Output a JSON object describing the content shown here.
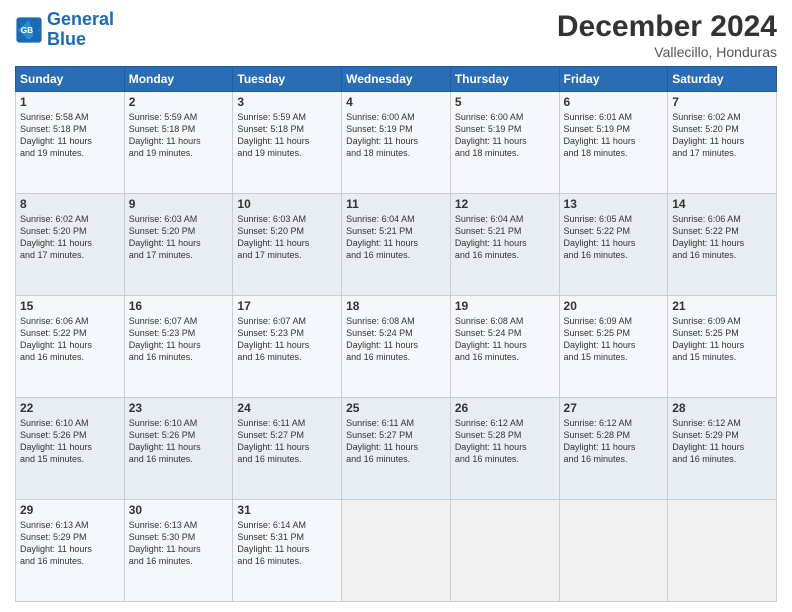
{
  "logo": {
    "line1": "General",
    "line2": "Blue"
  },
  "title": "December 2024",
  "subtitle": "Vallecillo, Honduras",
  "days_header": [
    "Sunday",
    "Monday",
    "Tuesday",
    "Wednesday",
    "Thursday",
    "Friday",
    "Saturday"
  ],
  "weeks": [
    [
      {
        "day": "1",
        "info": "Sunrise: 5:58 AM\nSunset: 5:18 PM\nDaylight: 11 hours\nand 19 minutes."
      },
      {
        "day": "2",
        "info": "Sunrise: 5:59 AM\nSunset: 5:18 PM\nDaylight: 11 hours\nand 19 minutes."
      },
      {
        "day": "3",
        "info": "Sunrise: 5:59 AM\nSunset: 5:18 PM\nDaylight: 11 hours\nand 19 minutes."
      },
      {
        "day": "4",
        "info": "Sunrise: 6:00 AM\nSunset: 5:19 PM\nDaylight: 11 hours\nand 18 minutes."
      },
      {
        "day": "5",
        "info": "Sunrise: 6:00 AM\nSunset: 5:19 PM\nDaylight: 11 hours\nand 18 minutes."
      },
      {
        "day": "6",
        "info": "Sunrise: 6:01 AM\nSunset: 5:19 PM\nDaylight: 11 hours\nand 18 minutes."
      },
      {
        "day": "7",
        "info": "Sunrise: 6:02 AM\nSunset: 5:20 PM\nDaylight: 11 hours\nand 17 minutes."
      }
    ],
    [
      {
        "day": "8",
        "info": "Sunrise: 6:02 AM\nSunset: 5:20 PM\nDaylight: 11 hours\nand 17 minutes."
      },
      {
        "day": "9",
        "info": "Sunrise: 6:03 AM\nSunset: 5:20 PM\nDaylight: 11 hours\nand 17 minutes."
      },
      {
        "day": "10",
        "info": "Sunrise: 6:03 AM\nSunset: 5:20 PM\nDaylight: 11 hours\nand 17 minutes."
      },
      {
        "day": "11",
        "info": "Sunrise: 6:04 AM\nSunset: 5:21 PM\nDaylight: 11 hours\nand 16 minutes."
      },
      {
        "day": "12",
        "info": "Sunrise: 6:04 AM\nSunset: 5:21 PM\nDaylight: 11 hours\nand 16 minutes."
      },
      {
        "day": "13",
        "info": "Sunrise: 6:05 AM\nSunset: 5:22 PM\nDaylight: 11 hours\nand 16 minutes."
      },
      {
        "day": "14",
        "info": "Sunrise: 6:06 AM\nSunset: 5:22 PM\nDaylight: 11 hours\nand 16 minutes."
      }
    ],
    [
      {
        "day": "15",
        "info": "Sunrise: 6:06 AM\nSunset: 5:22 PM\nDaylight: 11 hours\nand 16 minutes."
      },
      {
        "day": "16",
        "info": "Sunrise: 6:07 AM\nSunset: 5:23 PM\nDaylight: 11 hours\nand 16 minutes."
      },
      {
        "day": "17",
        "info": "Sunrise: 6:07 AM\nSunset: 5:23 PM\nDaylight: 11 hours\nand 16 minutes."
      },
      {
        "day": "18",
        "info": "Sunrise: 6:08 AM\nSunset: 5:24 PM\nDaylight: 11 hours\nand 16 minutes."
      },
      {
        "day": "19",
        "info": "Sunrise: 6:08 AM\nSunset: 5:24 PM\nDaylight: 11 hours\nand 16 minutes."
      },
      {
        "day": "20",
        "info": "Sunrise: 6:09 AM\nSunset: 5:25 PM\nDaylight: 11 hours\nand 15 minutes."
      },
      {
        "day": "21",
        "info": "Sunrise: 6:09 AM\nSunset: 5:25 PM\nDaylight: 11 hours\nand 15 minutes."
      }
    ],
    [
      {
        "day": "22",
        "info": "Sunrise: 6:10 AM\nSunset: 5:26 PM\nDaylight: 11 hours\nand 15 minutes."
      },
      {
        "day": "23",
        "info": "Sunrise: 6:10 AM\nSunset: 5:26 PM\nDaylight: 11 hours\nand 16 minutes."
      },
      {
        "day": "24",
        "info": "Sunrise: 6:11 AM\nSunset: 5:27 PM\nDaylight: 11 hours\nand 16 minutes."
      },
      {
        "day": "25",
        "info": "Sunrise: 6:11 AM\nSunset: 5:27 PM\nDaylight: 11 hours\nand 16 minutes."
      },
      {
        "day": "26",
        "info": "Sunrise: 6:12 AM\nSunset: 5:28 PM\nDaylight: 11 hours\nand 16 minutes."
      },
      {
        "day": "27",
        "info": "Sunrise: 6:12 AM\nSunset: 5:28 PM\nDaylight: 11 hours\nand 16 minutes."
      },
      {
        "day": "28",
        "info": "Sunrise: 6:12 AM\nSunset: 5:29 PM\nDaylight: 11 hours\nand 16 minutes."
      }
    ],
    [
      {
        "day": "29",
        "info": "Sunrise: 6:13 AM\nSunset: 5:29 PM\nDaylight: 11 hours\nand 16 minutes."
      },
      {
        "day": "30",
        "info": "Sunrise: 6:13 AM\nSunset: 5:30 PM\nDaylight: 11 hours\nand 16 minutes."
      },
      {
        "day": "31",
        "info": "Sunrise: 6:14 AM\nSunset: 5:31 PM\nDaylight: 11 hours\nand 16 minutes."
      },
      {
        "day": "",
        "info": ""
      },
      {
        "day": "",
        "info": ""
      },
      {
        "day": "",
        "info": ""
      },
      {
        "day": "",
        "info": ""
      }
    ]
  ]
}
